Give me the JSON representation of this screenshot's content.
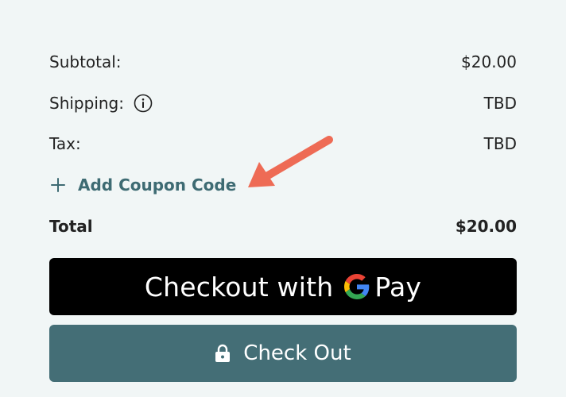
{
  "summary": {
    "subtotal_label": "Subtotal:",
    "subtotal_value": "$20.00",
    "shipping_label": "Shipping:",
    "shipping_value": "TBD",
    "tax_label": "Tax:",
    "tax_value": "TBD",
    "coupon_label": "Add Coupon Code",
    "total_label": "Total",
    "total_value": "$20.00"
  },
  "buttons": {
    "gpay_prefix": "Checkout with",
    "gpay_suffix": "Pay",
    "checkout_label": "Check Out"
  },
  "icons": {
    "info": "info-icon",
    "plus": "plus-icon",
    "google": "google-g-icon",
    "lock": "lock-icon"
  },
  "colors": {
    "background": "#f1f6f6",
    "accent": "#3e6b73",
    "checkout_button": "#446e76",
    "gpay_button": "#000000",
    "annotation_arrow": "#ee6b55"
  }
}
